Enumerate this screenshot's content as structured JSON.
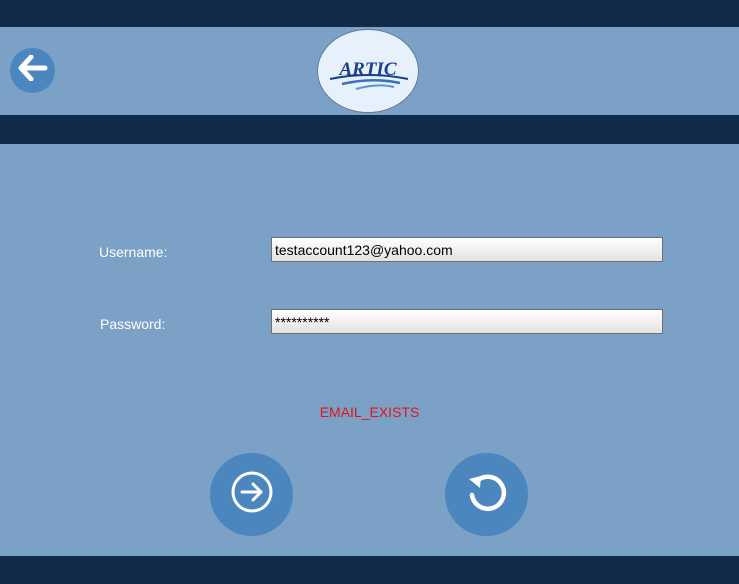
{
  "header": {
    "logo_text": "ARTIC",
    "back_icon": "back-arrow-icon"
  },
  "form": {
    "username_label": "Username:",
    "username_value": "testaccount123@yahoo.com",
    "password_label": "Password:",
    "password_value": "**********"
  },
  "status": {
    "error_message": "EMAIL_EXISTS"
  },
  "buttons": {
    "submit_icon": "arrow-right-circle-icon",
    "reset_icon": "refresh-icon"
  },
  "colors": {
    "background": "#7ba1c6",
    "dark_bar": "#132b4a",
    "button": "#4b86bf",
    "error": "#e3141b",
    "logo_text": "#1a3f8f"
  }
}
